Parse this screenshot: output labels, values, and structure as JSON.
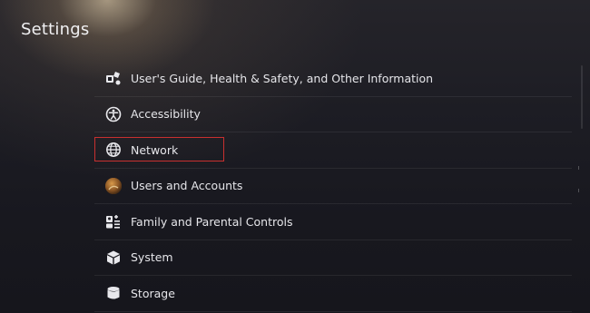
{
  "header": {
    "title": "Settings"
  },
  "settings": {
    "items": [
      {
        "label": "User's Guide, Health & Safety, and Other Information",
        "icon": "users-guide-icon",
        "selected": false
      },
      {
        "label": "Accessibility",
        "icon": "accessibility-icon",
        "selected": false
      },
      {
        "label": "Network",
        "icon": "globe-icon",
        "selected": true
      },
      {
        "label": "Users and Accounts",
        "icon": "user-avatar-icon",
        "selected": false
      },
      {
        "label": "Family and Parental Controls",
        "icon": "family-controls-icon",
        "selected": false
      },
      {
        "label": "System",
        "icon": "system-cube-icon",
        "selected": false
      },
      {
        "label": "Storage",
        "icon": "storage-icon",
        "selected": false
      }
    ]
  },
  "colors": {
    "focus_border": "#c8302f",
    "text": "#e6e6ea",
    "background": "#1d1d24"
  }
}
